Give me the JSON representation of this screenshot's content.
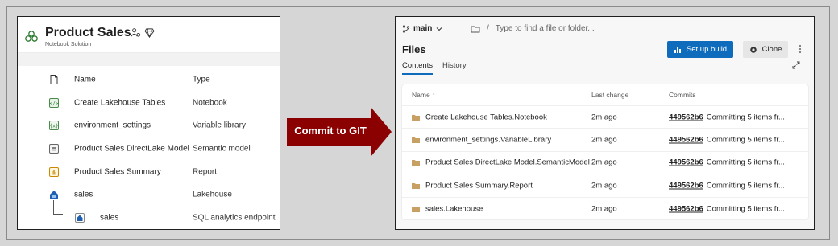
{
  "colors": {
    "primary_button": "#0f6cbd",
    "arrow": "#8b0000",
    "folder": "#c8a063"
  },
  "left": {
    "title": "Product Sales",
    "subtitle": "Notebook Solution",
    "columns": {
      "name": "Name",
      "type": "Type"
    },
    "items": [
      {
        "name": "Create Lakehouse Tables",
        "type": "Notebook",
        "icon": "notebook-icon"
      },
      {
        "name": "environment_settings",
        "type": "Variable library",
        "icon": "variable-library-icon"
      },
      {
        "name": "Product Sales DirectLake Model",
        "type": "Semantic model",
        "icon": "semantic-model-icon"
      },
      {
        "name": "Product Sales Summary",
        "type": "Report",
        "icon": "report-icon"
      },
      {
        "name": "sales",
        "type": "Lakehouse",
        "icon": "lakehouse-icon"
      },
      {
        "name": "sales",
        "type": "SQL analytics endpoint",
        "icon": "sql-endpoint-icon"
      }
    ]
  },
  "arrow": {
    "label": "Commit to GIT"
  },
  "right": {
    "branch": "main",
    "path_placeholder": "Type to find a file or folder...",
    "title": "Files",
    "setup_button": "Set up build",
    "clone_button": "Clone",
    "tabs": [
      "Contents",
      "History"
    ],
    "columns": {
      "name": "Name ↑",
      "last_change": "Last change",
      "commits": "Commits"
    },
    "files": [
      {
        "name": "Create Lakehouse Tables.Notebook",
        "last_change": "2m ago",
        "hash": "449562b6",
        "message": "Committing 5 items fr..."
      },
      {
        "name": "environment_settings.VariableLibrary",
        "last_change": "2m ago",
        "hash": "449562b6",
        "message": "Committing 5 items fr..."
      },
      {
        "name": "Product Sales DirectLake Model.SemanticModel",
        "last_change": "2m ago",
        "hash": "449562b6",
        "message": "Committing 5 items fr..."
      },
      {
        "name": "Product Sales Summary.Report",
        "last_change": "2m ago",
        "hash": "449562b6",
        "message": "Committing 5 items fr..."
      },
      {
        "name": "sales.Lakehouse",
        "last_change": "2m ago",
        "hash": "449562b6",
        "message": "Committing 5 items fr..."
      }
    ]
  }
}
